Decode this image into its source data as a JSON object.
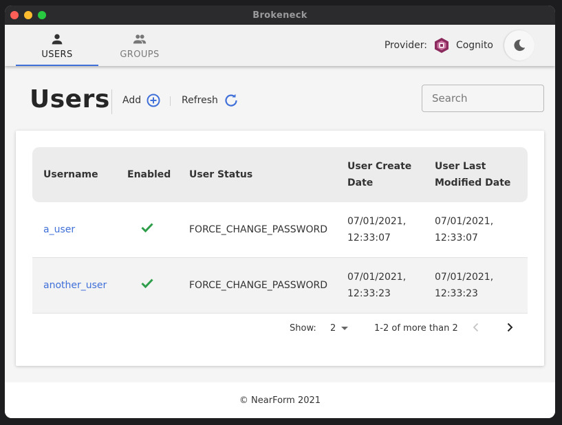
{
  "window": {
    "title": "Brokeneck"
  },
  "nav": {
    "tabs": [
      {
        "label": "USERS",
        "icon": "person-icon",
        "active": true
      },
      {
        "label": "GROUPS",
        "icon": "group-icon",
        "active": false
      }
    ],
    "provider_label": "Provider:",
    "provider_name": "Cognito",
    "theme_toggle_icon": "moon-icon"
  },
  "page": {
    "title": "Users",
    "add_label": "Add",
    "refresh_label": "Refresh",
    "search_placeholder": "Search"
  },
  "table": {
    "columns": [
      "Username",
      "Enabled",
      "User Status",
      "User Create Date",
      "User Last Modified Date"
    ],
    "rows": [
      {
        "username": "a_user",
        "enabled": true,
        "status": "FORCE_CHANGE_PASSWORD",
        "created_date": "07/01/2021,",
        "created_time": "12:33:07",
        "modified_date": "07/01/2021,",
        "modified_time": "12:33:07"
      },
      {
        "username": "another_user",
        "enabled": true,
        "status": "FORCE_CHANGE_PASSWORD",
        "created_date": "07/01/2021,",
        "created_time": "12:33:23",
        "modified_date": "07/01/2021,",
        "modified_time": "12:33:23"
      }
    ]
  },
  "pagination": {
    "show_label": "Show:",
    "page_size": "2",
    "range_text": "1-2 of more than 2"
  },
  "footer": {
    "text": "©  NearForm 2021"
  },
  "colors": {
    "accent": "#3f6fd8",
    "check": "#2e9e4a",
    "provider_icon": "#8b2a5c"
  }
}
